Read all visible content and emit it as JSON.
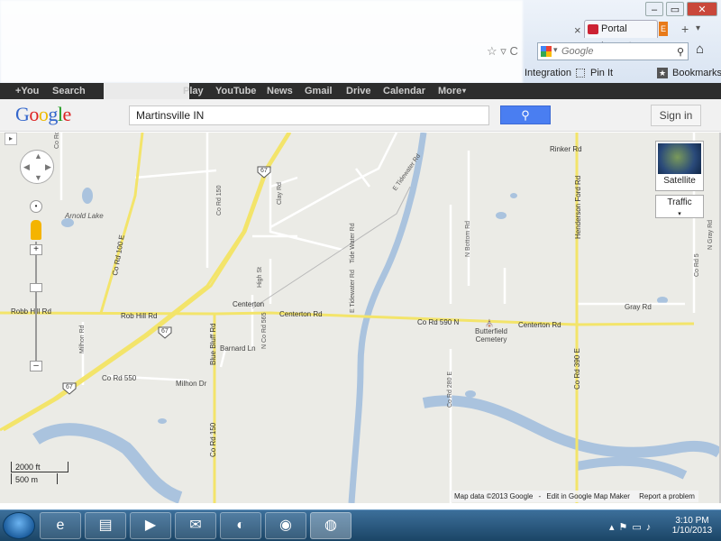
{
  "browser": {
    "tab_title": "Portal Logout",
    "tab_extra": "E",
    "search_engine_placeholder": "Google",
    "bookmarks": [
      "Integration",
      "Pin It",
      "Bookmarks"
    ]
  },
  "google_bar": {
    "items": [
      "+You",
      "Search",
      "Play",
      "YouTube",
      "News",
      "Gmail",
      "Drive",
      "Calendar",
      "More"
    ]
  },
  "header": {
    "logo": "Google",
    "query": "Martinsville IN",
    "search_button_icon": "search-icon",
    "sign_in": "Sign in"
  },
  "map": {
    "controls": {
      "satellite": "Satellite",
      "traffic": "Traffic"
    },
    "scale": {
      "imperial": "2000 ft",
      "metric": "500 m"
    },
    "attribution": {
      "data": "Map data ©2013 Google",
      "edit": "Edit in Google Map Maker",
      "report": "Report a problem"
    },
    "labels": {
      "co_rd_top": "Co Rd",
      "co_rd_100e": "Co Rd 100 E",
      "arnold_lake": "Arnold Lake",
      "co_rd_150": "Co Rd 150",
      "clay_rd": "Clay Rd",
      "hwy_67_top": "67",
      "hwy_67_mid": "67",
      "hwy_67_low": "67",
      "e_tidewater_rd": "E Tidewater Rd",
      "tide_water_rd": "Tide Water Rd",
      "e_tidewater_rd2": "E Tidewater Rd",
      "n_bottom_rd": "N Bottom Rd",
      "rinker_rd": "Rinker Rd",
      "henderson_ford_rd": "Henderson Ford Rd",
      "n_gray_rd": "N Gray Rd",
      "co_rd_e": "Co Rd 5",
      "high_st": "High St",
      "centerton": "Centerton",
      "robb_hill_rd": "Robb Hill Rd",
      "rob_hill_rd": "Rob Hill Rd",
      "centerton_rd": "Centerton Rd",
      "co_rd_590n": "Co Rd 590 N",
      "centerton_rd2": "Centerton Rd",
      "gray_rd": "Gray Rd",
      "n_co_rd_565": "N Co Rd 565",
      "milhon_rd": "Milhon Rd",
      "barnard_ln": "Barnard Ln",
      "blue_bluff_rd": "Blue Bluff Rd",
      "butterfield_cemetery": "Butterfield Cemetery",
      "co_rd_550": "Co Rd 550",
      "milhon_dr": "Milhon Dr",
      "co_rd_280e": "Co Rd 280 E",
      "co_rd_390e": "Co Rd 390 E",
      "co_rd_150_low": "Co Rd 150"
    }
  },
  "taskbar": {
    "apps": [
      "internet-explorer-icon",
      "file-explorer-icon",
      "media-player-icon",
      "outlook-icon",
      "app-icon",
      "chrome-icon",
      "firefox-icon"
    ],
    "time": "3:10 PM",
    "date": "1/10/2013"
  }
}
